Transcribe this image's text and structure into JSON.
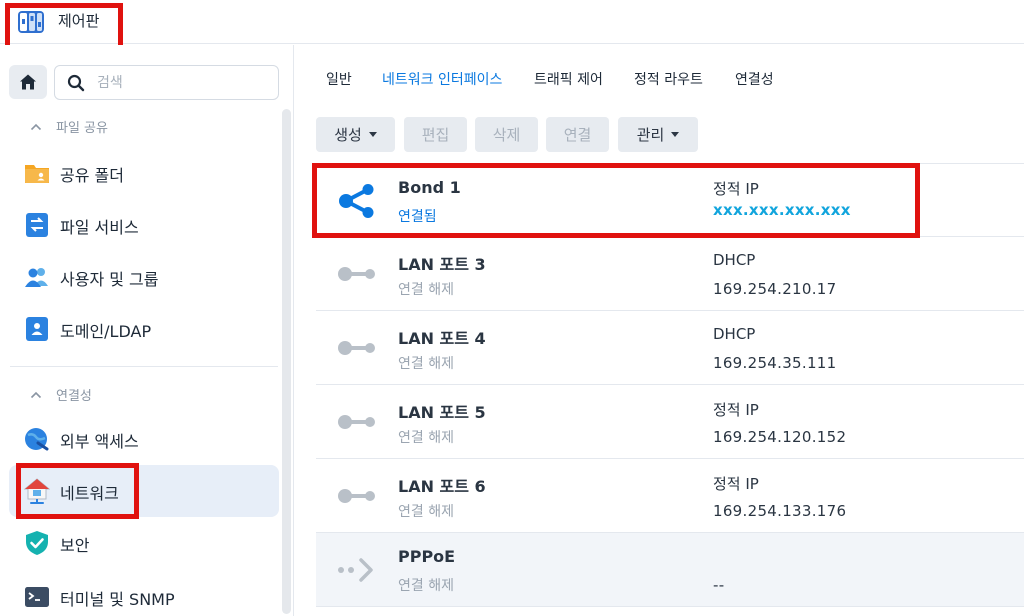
{
  "window": {
    "title": "제어판",
    "icon": "control-panel-icon"
  },
  "sidebar": {
    "home_icon": "home-icon",
    "search": {
      "placeholder": "검색",
      "value": ""
    },
    "sections": [
      {
        "label": "파일 공유",
        "items": [
          {
            "label": "공유 폴더",
            "icon": "shared-folder-icon"
          },
          {
            "label": "파일 서비스",
            "icon": "file-services-icon"
          },
          {
            "label": "사용자 및 그룹",
            "icon": "users-groups-icon"
          },
          {
            "label": "도메인/LDAP",
            "icon": "domain-ldap-icon"
          }
        ]
      },
      {
        "label": "연결성",
        "items": [
          {
            "label": "외부 액세스",
            "icon": "external-access-icon"
          },
          {
            "label": "네트워크",
            "icon": "network-icon",
            "active": true
          },
          {
            "label": "보안",
            "icon": "security-shield-icon"
          },
          {
            "label": "터미널 및 SNMP",
            "icon": "terminal-icon"
          }
        ]
      }
    ]
  },
  "tabs": [
    {
      "label": "일반"
    },
    {
      "label": "네트워크 인터페이스",
      "active": true
    },
    {
      "label": "트래픽 제어"
    },
    {
      "label": "정적 라우트"
    },
    {
      "label": "연결성"
    }
  ],
  "toolbar": {
    "create": "생성",
    "edit": "편집",
    "delete": "삭제",
    "connect": "연결",
    "manage": "관리"
  },
  "interfaces": [
    {
      "name": "Bond 1",
      "status": "연결됨",
      "type": "정적 IP",
      "ip": "xxx.xxx.xxx.xxx",
      "icon": "bond-share-icon",
      "connected": true
    },
    {
      "name": "LAN 포트 3",
      "status": "연결 해제",
      "type": "DHCP",
      "ip": "169.254.210.17",
      "icon": "lan-port-icon"
    },
    {
      "name": "LAN 포트 4",
      "status": "연결 해제",
      "type": "DHCP",
      "ip": "169.254.35.111",
      "icon": "lan-port-icon"
    },
    {
      "name": "LAN 포트 5",
      "status": "연결 해제",
      "type": "정적 IP",
      "ip": "169.254.120.152",
      "icon": "lan-port-icon"
    },
    {
      "name": "LAN 포트 6",
      "status": "연결 해제",
      "type": "정적 IP",
      "ip": "169.254.133.176",
      "icon": "lan-port-icon"
    },
    {
      "name": "PPPoE",
      "status": "연결 해제",
      "type": "",
      "ip": "--",
      "icon": "pppoe-icon"
    }
  ],
  "colors": {
    "accent": "#0b79e0",
    "highlight": "#e0120f",
    "masked_ip": "#12a5dd"
  }
}
